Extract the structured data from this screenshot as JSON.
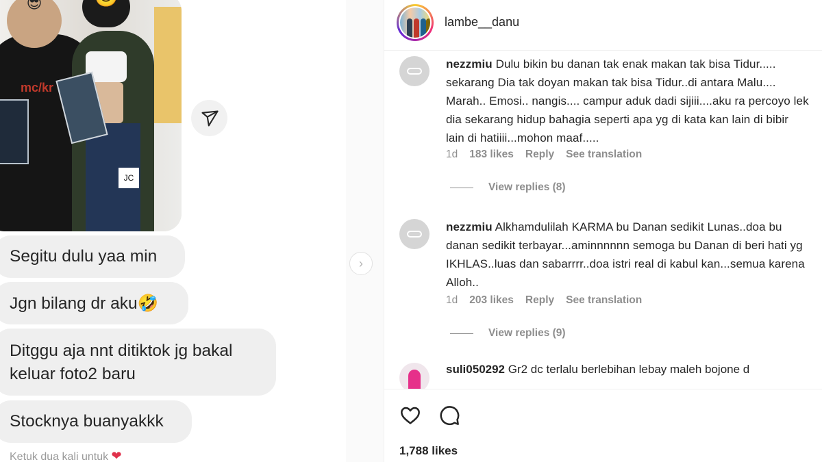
{
  "chat": {
    "messages": [
      "Segitu dulu yaa min",
      "Jgn bilang dr aku🤣",
      "Ditggu aja nnt ditiktok jg bakal keluar foto2 baru",
      "Stocknya buanyakkk"
    ],
    "hint": "Ketuk dua kali untuk",
    "hint_heart": "❤"
  },
  "post": {
    "username": "lambe__danu",
    "likes": "1,788 likes"
  },
  "comments": [
    {
      "user": "nezzmiu",
      "text": "Dulu bikin bu danan tak enak makan tak bisa Tidur..... sekarang Dia tak doyan makan tak bisa Tidur..di antara Malu.... Marah.. Emosi.. nangis.... campur aduk dadi sijiii....aku ra percoyo lek dia sekarang hidup bahagia seperti apa yg di kata kan lain di bibir lain di hatiiii...mohon maaf.....",
      "time": "1d",
      "likes": "183 likes",
      "reply": "Reply",
      "translate": "See translation",
      "view_replies": "View replies (8)"
    },
    {
      "user": "nezzmiu",
      "text": "Alkhamdulilah KARMA bu Danan sedikit Lunas..doa bu danan sedikit terbayar...aminnnnnn semoga bu Danan di beri hati yg IKHLAS..luas dan sabarrrr..doa istri real di kabul kan...semua karena Alloh..",
      "time": "1d",
      "likes": "203 likes",
      "reply": "Reply",
      "translate": "See translation",
      "view_replies": "View replies (9)"
    },
    {
      "user": "suli050292",
      "text": "Gr2 dc terlalu berlebihan lebay maleh bojone d"
    }
  ],
  "icons": {
    "send": "send-icon",
    "next": "chevron-right-icon",
    "like": "heart-icon",
    "comment": "comment-icon"
  },
  "colors": {
    "bubble": "#efefef",
    "meta_text": "#8e8e8e",
    "heart_red": "#e0314b"
  }
}
